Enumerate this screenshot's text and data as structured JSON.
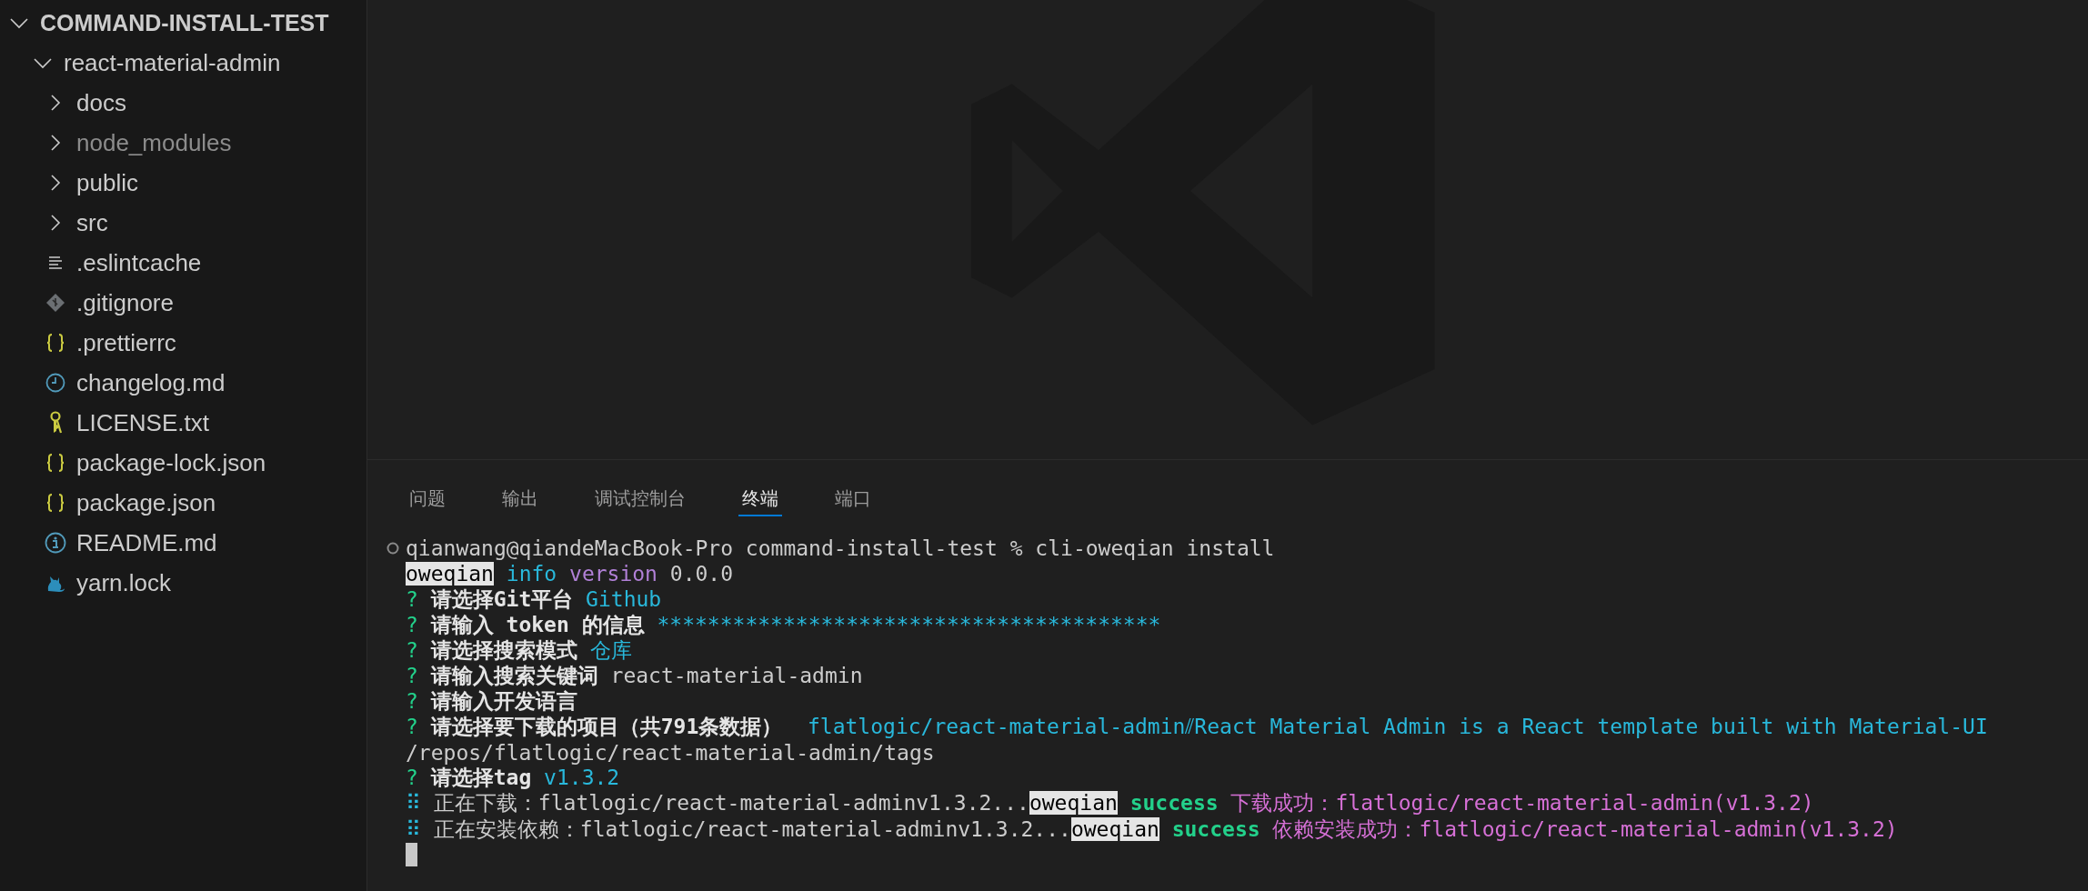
{
  "explorer": {
    "root": {
      "label": "COMMAND-INSTALL-TEST",
      "expanded": true,
      "children": [
        {
          "label": "react-material-admin",
          "kind": "folder",
          "expanded": true,
          "children": [
            {
              "label": "docs",
              "kind": "folder",
              "expanded": false,
              "ignored": false
            },
            {
              "label": "node_modules",
              "kind": "folder",
              "expanded": false,
              "ignored": true
            },
            {
              "label": "public",
              "kind": "folder",
              "expanded": false,
              "ignored": false
            },
            {
              "label": "src",
              "kind": "folder",
              "expanded": false,
              "ignored": false
            },
            {
              "label": ".eslintcache",
              "kind": "lines",
              "ignored": false
            },
            {
              "label": ".gitignore",
              "kind": "git",
              "ignored": false
            },
            {
              "label": ".prettierrc",
              "kind": "braces",
              "ignored": false
            },
            {
              "label": "changelog.md",
              "kind": "clock",
              "ignored": false
            },
            {
              "label": "LICENSE.txt",
              "kind": "key",
              "ignored": false
            },
            {
              "label": "package-lock.json",
              "kind": "braces",
              "ignored": false
            },
            {
              "label": "package.json",
              "kind": "braces",
              "ignored": false
            },
            {
              "label": "README.md",
              "kind": "info",
              "ignored": false
            },
            {
              "label": "yarn.lock",
              "kind": "yarn",
              "ignored": false
            }
          ]
        }
      ]
    }
  },
  "panel": {
    "tabs": [
      {
        "label": "问题",
        "selected": false
      },
      {
        "label": "输出",
        "selected": false
      },
      {
        "label": "调试控制台",
        "selected": false
      },
      {
        "label": "终端",
        "selected": true
      },
      {
        "label": "端口",
        "selected": false
      }
    ],
    "terminal": {
      "lines": [
        {
          "kind": "prompt",
          "segments": [
            {
              "text": "qianwang@qiandeMacBook-Pro command-install-test % cli-oweqian install",
              "kind": "plain"
            }
          ]
        },
        {
          "kind": "text",
          "segments": [
            {
              "text": "oweqian",
              "kind": "label"
            },
            {
              "text": " info",
              "kind": "cyan"
            },
            {
              "text": " version",
              "kind": "purple"
            },
            {
              "text": " 0.0.0",
              "kind": "plain"
            }
          ]
        },
        {
          "kind": "text",
          "segments": [
            {
              "text": "?",
              "kind": "green"
            },
            {
              "text": " 请选择Git平台 ",
              "kind": "bold"
            },
            {
              "text": "Github",
              "kind": "cyan"
            }
          ]
        },
        {
          "kind": "text",
          "segments": [
            {
              "text": "?",
              "kind": "green"
            },
            {
              "text": " 请输入 token 的信息 ",
              "kind": "bold"
            },
            {
              "text": "****************************************",
              "kind": "cyan"
            }
          ]
        },
        {
          "kind": "text",
          "segments": [
            {
              "text": "?",
              "kind": "green"
            },
            {
              "text": " 请选择搜索模式 ",
              "kind": "bold"
            },
            {
              "text": "仓库",
              "kind": "cyan"
            }
          ]
        },
        {
          "kind": "text",
          "segments": [
            {
              "text": "?",
              "kind": "green"
            },
            {
              "text": " 请输入搜索关键词 ",
              "kind": "bold"
            },
            {
              "text": "react-material-admin",
              "kind": "plain"
            }
          ]
        },
        {
          "kind": "text",
          "segments": [
            {
              "text": "?",
              "kind": "green"
            },
            {
              "text": " 请输入开发语言",
              "kind": "bold"
            }
          ]
        },
        {
          "kind": "text",
          "segments": [
            {
              "text": "?",
              "kind": "green"
            },
            {
              "text": " 请选择要下载的项目（共791条数据）  ",
              "kind": "bold"
            },
            {
              "text": "flatlogic/react-material-admin⫽React Material Admin is a React template built with Material-UI",
              "kind": "cyan"
            }
          ]
        },
        {
          "kind": "text",
          "segments": [
            {
              "text": "/repos/flatlogic/react-material-admin/tags",
              "kind": "plain"
            }
          ]
        },
        {
          "kind": "text",
          "segments": [
            {
              "text": "?",
              "kind": "green"
            },
            {
              "text": " 请选择tag ",
              "kind": "bold"
            },
            {
              "text": "v1.3.2",
              "kind": "cyan"
            }
          ]
        },
        {
          "kind": "text",
          "segments": [
            {
              "text": "⠿",
              "kind": "cyan"
            },
            {
              "text": " 正在下载：flatlogic/react-material-adminv1.3.2...",
              "kind": "plain"
            },
            {
              "text": "oweqian",
              "kind": "label"
            },
            {
              "text": " success",
              "kind": "green-bold"
            },
            {
              "text": " 下载成功：flatlogic/react-material-admin(v1.3.2)",
              "kind": "magenta"
            }
          ]
        },
        {
          "kind": "text",
          "segments": [
            {
              "text": "⠿",
              "kind": "cyan"
            },
            {
              "text": " 正在安装依赖：flatlogic/react-material-adminv1.3.2...",
              "kind": "plain"
            },
            {
              "text": "oweqian",
              "kind": "label"
            },
            {
              "text": " success",
              "kind": "green-bold"
            },
            {
              "text": " 依赖安装成功：flatlogic/react-material-admin(v1.3.2)",
              "kind": "magenta"
            }
          ]
        },
        {
          "kind": "cursor"
        }
      ]
    }
  }
}
